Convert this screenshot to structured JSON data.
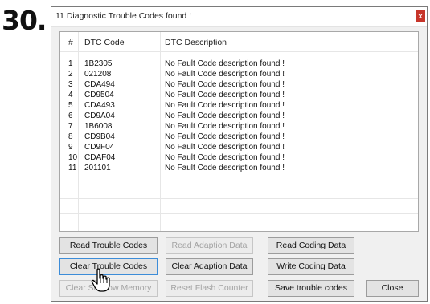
{
  "step_label": "30.",
  "window": {
    "title": "11 Diagnostic Trouble Codes found !",
    "close_glyph": "x"
  },
  "table": {
    "headers": [
      "#",
      "DTC Code",
      "DTC Description"
    ],
    "rows": [
      [
        "1",
        "1B2305",
        "No Fault Code description found !"
      ],
      [
        "2",
        "021208",
        "No Fault Code description found !"
      ],
      [
        "3",
        "CDA494",
        "No Fault Code description found !"
      ],
      [
        "4",
        "CD9504",
        "No Fault Code description found !"
      ],
      [
        "5",
        "CDA493",
        "No Fault Code description found !"
      ],
      [
        "6",
        "CD9A04",
        "No Fault Code description found !"
      ],
      [
        "7",
        "1B6008",
        "No Fault Code description found !"
      ],
      [
        "8",
        "CD9B04",
        "No Fault Code description found !"
      ],
      [
        "9",
        "CD9F04",
        "No Fault Code description found !"
      ],
      [
        "10",
        "CDAF04",
        "No Fault Code description found !"
      ],
      [
        "11",
        "201101",
        "No Fault Code description found !"
      ]
    ]
  },
  "buttons": {
    "read_trouble_codes": "Read Trouble Codes",
    "read_adaption_data": "Read Adaption Data",
    "read_coding_data": "Read Coding Data",
    "clear_trouble_codes": "Clear Trouble Codes",
    "clear_adaption_data": "Clear Adaption Data",
    "write_coding_data": "Write Coding Data",
    "clear_shadow_memory": "Clear Shadow Memory",
    "reset_flash_counter": "Reset Flash Counter",
    "save_trouble_codes": "Save trouble codes",
    "close": "Close"
  },
  "icons": {
    "cursor": "hand-pointer-icon",
    "close": "close-icon"
  },
  "colors": {
    "close_button": "#c7352a",
    "focus_border": "#3c8cd8",
    "disabled_text": "#a3a3a3"
  }
}
